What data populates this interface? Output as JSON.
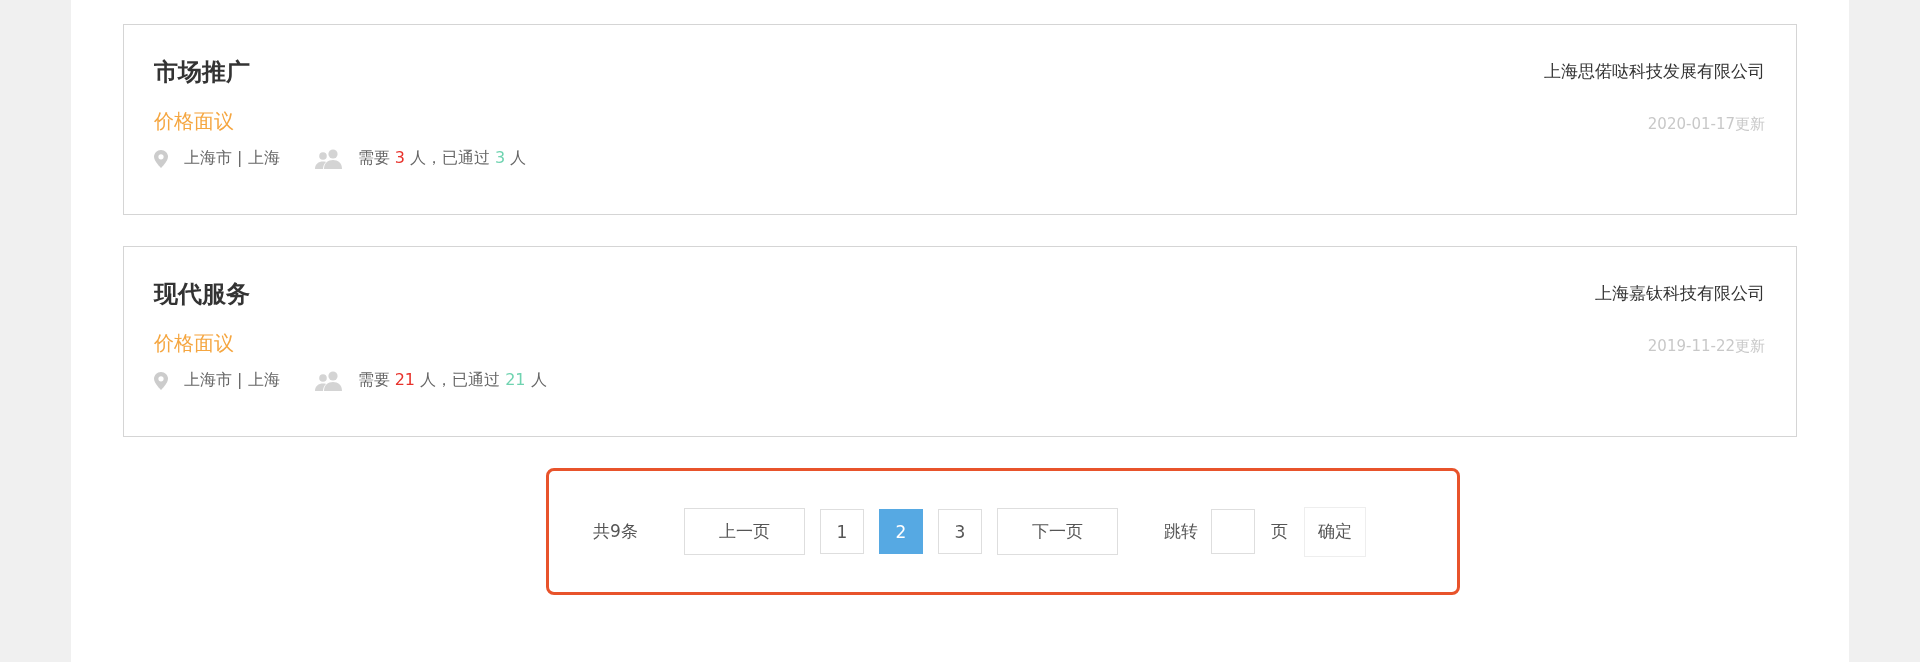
{
  "jobs": [
    {
      "title": "市场推广",
      "price": "价格面议",
      "location": "上海市 | 上海",
      "need_prefix": "需要",
      "need": "3",
      "middle": "人，已通过",
      "passed": "3",
      "suffix": "人",
      "company": "上海思偌哒科技发展有限公司",
      "updated": "2020-01-17更新"
    },
    {
      "title": "现代服务",
      "price": "价格面议",
      "location": "上海市 | 上海",
      "need_prefix": "需要",
      "need": "21",
      "middle": "人，已通过",
      "passed": "21",
      "suffix": "人",
      "company": "上海嘉钛科技有限公司",
      "updated": "2019-11-22更新"
    }
  ],
  "pagination": {
    "total": "共9条",
    "prev": "上一页",
    "pages": [
      {
        "label": "1",
        "selected": false
      },
      {
        "label": "2",
        "selected": true
      },
      {
        "label": "3",
        "selected": false
      }
    ],
    "next": "下一页",
    "jump_label": "跳转",
    "page_unit": "页",
    "confirm": "确定"
  }
}
